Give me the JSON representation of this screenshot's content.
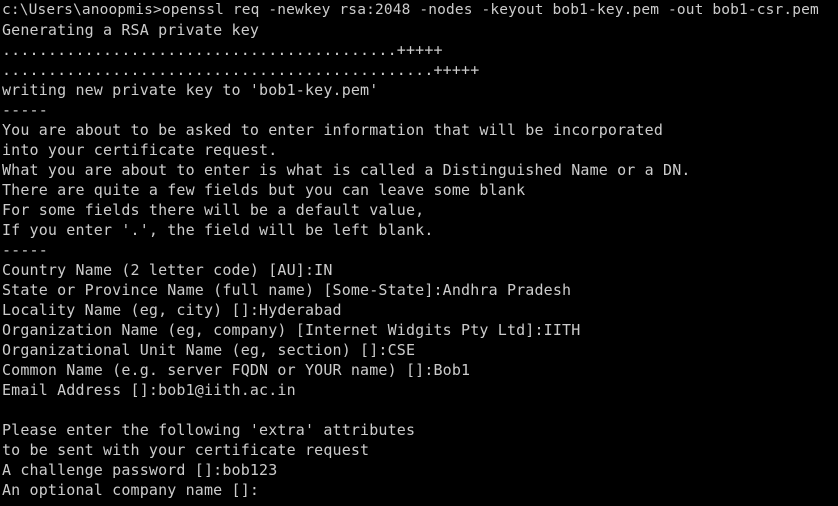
{
  "console": {
    "lines": [
      "c:\\Users\\anoopmis>openssl req -newkey rsa:2048 -nodes -keyout bob1-key.pem -out bob1-csr.pem",
      "Generating a RSA private key",
      "...........................................+++++",
      "...............................................+++++",
      "writing new private key to 'bob1-key.pem'",
      "-----",
      "You are about to be asked to enter information that will be incorporated",
      "into your certificate request.",
      "What you are about to enter is what is called a Distinguished Name or a DN.",
      "There are quite a few fields but you can leave some blank",
      "For some fields there will be a default value,",
      "If you enter '.', the field will be left blank.",
      "-----",
      "Country Name (2 letter code) [AU]:IN",
      "State or Province Name (full name) [Some-State]:Andhra Pradesh",
      "Locality Name (eg, city) []:Hyderabad",
      "Organization Name (eg, company) [Internet Widgits Pty Ltd]:IITH",
      "Organizational Unit Name (eg, section) []:CSE",
      "Common Name (e.g. server FQDN or YOUR name) []:Bob1",
      "Email Address []:bob1@iith.ac.in",
      "",
      "Please enter the following 'extra' attributes",
      "to be sent with your certificate request",
      "A challenge password []:bob123",
      "An optional company name []:"
    ]
  },
  "colors": {
    "background": "#000000",
    "foreground": "#cccccc"
  }
}
